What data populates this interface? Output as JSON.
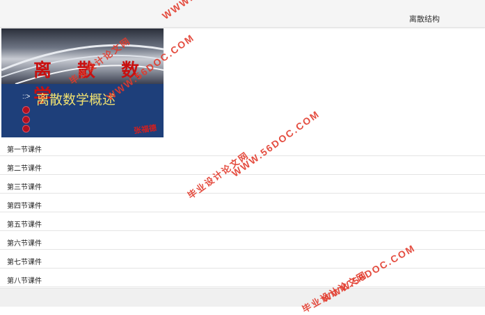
{
  "header": {
    "title": "离散结构"
  },
  "banner": {
    "title": "离 散 数 学",
    "subtitle": "离散数学概述",
    "arrow": "::>",
    "signature": "张福德"
  },
  "lessons": [
    "第一节课件",
    "第二节课件",
    "第三节课件",
    "第四节课件",
    "第五节课件",
    "第六节课件",
    "第七节课件",
    "第八节课件"
  ],
  "watermark": {
    "site": "WWW.56DOC.COM",
    "cn": "毕业设计论文网"
  },
  "colors": {
    "accent": "#1e3f7a",
    "watermark": "#e23a2c"
  }
}
